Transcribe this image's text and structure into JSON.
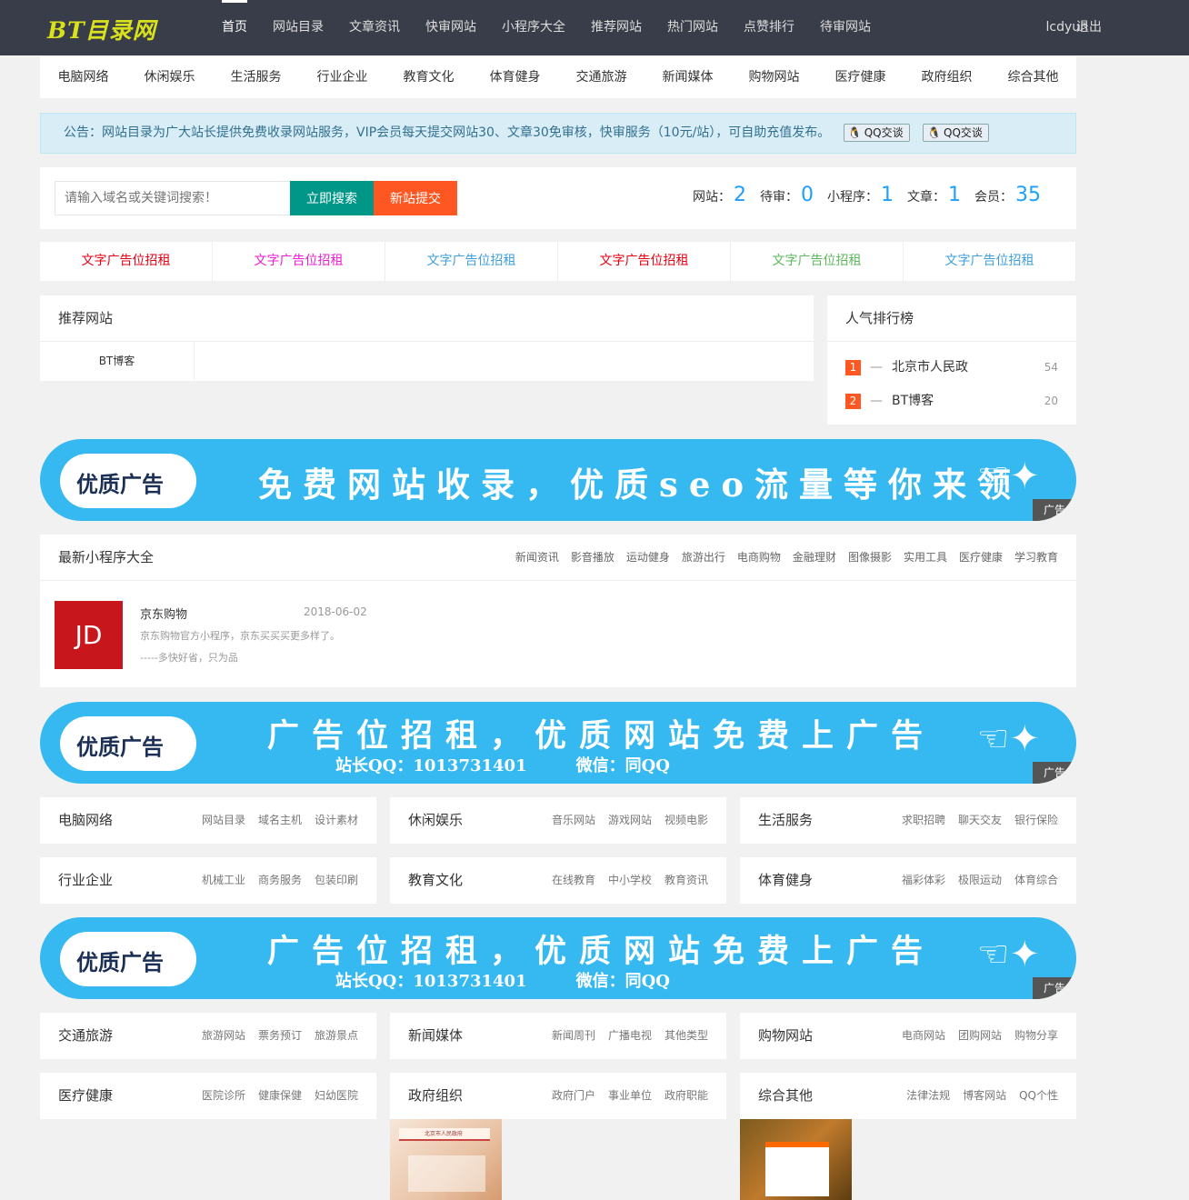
{
  "header": {
    "logo": "BT目录网",
    "nav": [
      "首页",
      "网站目录",
      "文章资讯",
      "快审网站",
      "小程序大全",
      "推荐网站",
      "热门网站",
      "点赞排行",
      "待审网站"
    ],
    "user": "lcdyun",
    "logout": "退出"
  },
  "categories": [
    "电脑网络",
    "休闲娱乐",
    "生活服务",
    "行业企业",
    "教育文化",
    "体育健身",
    "交通旅游",
    "新闻媒体",
    "购物网站",
    "医疗健康",
    "政府组织",
    "综合其他"
  ],
  "notice": {
    "text": "公告：网站目录为广大站长提供免费收录网站服务，VIP会员每天提交网站30、文章30免审核，快审服务（10元/站），可自助充值发布。",
    "qq1": "QQ交谈",
    "qq2": "QQ交谈"
  },
  "search": {
    "placeholder": "请输入域名或关键词搜索！",
    "search_btn": "立即搜索",
    "submit_btn": "新站提交"
  },
  "stats": [
    {
      "label": "网站：",
      "value": "2"
    },
    {
      "label": "待审：",
      "value": "0"
    },
    {
      "label": "小程序：",
      "value": "1"
    },
    {
      "label": "文章：",
      "value": "1"
    },
    {
      "label": "会员：",
      "value": "35"
    }
  ],
  "text_ads": [
    {
      "label": "文字广告位招租",
      "color": "#e60012"
    },
    {
      "label": "文字广告位招租",
      "color": "#e91ecf"
    },
    {
      "label": "文字广告位招租",
      "color": "#3e9fd9"
    },
    {
      "label": "文字广告位招租",
      "color": "#e60012"
    },
    {
      "label": "文字广告位招租",
      "color": "#5cb85c"
    },
    {
      "label": "文字广告位招租",
      "color": "#3e9fd9"
    }
  ],
  "recommend": {
    "title": "推荐网站",
    "items": [
      "BT博客"
    ]
  },
  "ranking": {
    "title": "人气排行榜",
    "items": [
      {
        "num": "1",
        "name": "北京市人民政",
        "count": "54"
      },
      {
        "num": "2",
        "name": "BT博客",
        "count": "20"
      }
    ]
  },
  "banners": [
    {
      "badge": "优质广告",
      "headline": "免费网站收录，优质seo流量等你来领",
      "sub": "",
      "tag": "广告"
    },
    {
      "badge": "优质广告",
      "headline": "广告位招租，优质网站免费上广告",
      "sub": "站长QQ：1013731401　　　微信：同QQ",
      "tag": "广告"
    },
    {
      "badge": "优质广告",
      "headline": "广告位招租，优质网站免费上广告",
      "sub": "站长QQ：1013731401　　　微信：同QQ",
      "tag": "广告"
    }
  ],
  "miniprograms": {
    "title": "最新小程序大全",
    "tabs": [
      "新闻资讯",
      "影音播放",
      "运动健身",
      "旅游出行",
      "电商购物",
      "金融理财",
      "图像摄影",
      "实用工具",
      "医疗健康",
      "学习教育"
    ],
    "item": {
      "logo": "JD",
      "name": "京东购物",
      "date": "2018-06-02",
      "desc1": "京东购物官方小程序，京东买买买更多样了。",
      "desc2": "-----多快好省，只为品"
    }
  },
  "cat_panels": [
    {
      "title": "电脑网络",
      "subs": [
        "网站目录",
        "域名主机",
        "设计素材"
      ]
    },
    {
      "title": "休闲娱乐",
      "subs": [
        "音乐网站",
        "游戏网站",
        "视频电影"
      ]
    },
    {
      "title": "生活服务",
      "subs": [
        "求职招聘",
        "聊天交友",
        "银行保险"
      ]
    },
    {
      "title": "行业企业",
      "subs": [
        "机械工业",
        "商务服务",
        "包装印刷"
      ]
    },
    {
      "title": "教育文化",
      "subs": [
        "在线教育",
        "中小学校",
        "教育资讯"
      ]
    },
    {
      "title": "体育健身",
      "subs": [
        "福彩体彩",
        "极限运动",
        "体育综合"
      ]
    },
    {
      "title": "交通旅游",
      "subs": [
        "旅游网站",
        "票务预订",
        "旅游景点"
      ]
    },
    {
      "title": "新闻媒体",
      "subs": [
        "新闻周刊",
        "广播电视",
        "其他类型"
      ]
    },
    {
      "title": "购物网站",
      "subs": [
        "电商网站",
        "团购网站",
        "购物分享"
      ]
    },
    {
      "title": "医疗健康",
      "subs": [
        "医院诊所",
        "健康保健",
        "妇幼医院"
      ]
    },
    {
      "title": "政府组织",
      "subs": [
        "政府门户",
        "事业单位",
        "政府职能"
      ]
    },
    {
      "title": "综合其他",
      "subs": [
        "法律法规",
        "博客网站",
        "QQ个性"
      ]
    }
  ],
  "thumbs": [
    {
      "caption": "北京市人民政府"
    }
  ]
}
